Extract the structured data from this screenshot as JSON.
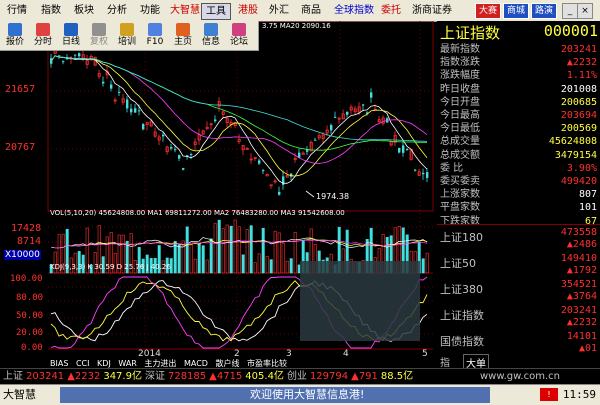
{
  "menu": {
    "items": [
      "行情",
      "指数",
      "板块",
      "分析",
      "功能",
      "大智慧",
      "工具",
      "港股",
      "外汇",
      "商品",
      "全球指数",
      "委托",
      "浙商证券"
    ],
    "right_buttons": [
      "大赛",
      "商城",
      "路演"
    ]
  },
  "toolbar": {
    "items": [
      {
        "label": "报价",
        "color": "#3070d0"
      },
      {
        "label": "分时",
        "color": "#e04040"
      },
      {
        "label": "日线",
        "color": "#2060c0"
      },
      {
        "label": "复权",
        "color": "#909090"
      },
      {
        "label": "培训",
        "color": "#d0a020"
      },
      {
        "label": "F10",
        "color": "#5080e0"
      },
      {
        "label": "主页",
        "color": "#e06020"
      },
      {
        "label": "信息",
        "color": "#4080d0"
      },
      {
        "label": "论坛",
        "color": "#d04080"
      }
    ],
    "overlay_text": "3.75  MA20 2090.16"
  },
  "chart": {
    "price_axis": [
      "21657",
      "20767"
    ],
    "low_marker": "1974.38",
    "vol_line": "VOL(5,10,20)  45624808.00  MA1 69811272.00  MA2 76483280.00  MA3 91542608.00",
    "vol_axis": [
      "17428",
      "8714",
      "X10000"
    ],
    "kdj_line": "KDJ(9,3,3)  K 30.59  D 25.76  J 40.26",
    "kdj_axis": [
      "100.00",
      "80.00",
      "50.00",
      "20.00",
      "0.00"
    ],
    "x_labels": [
      "2014",
      "2",
      "3",
      "4",
      "5"
    ],
    "indicator_tabs": [
      "BIAS",
      "CCI",
      "KDJ",
      "WAR",
      "主力进出",
      "MACD",
      "散户线",
      "市盈率比较"
    ]
  },
  "quote": {
    "title": "上证指数",
    "code": "000001",
    "rows": [
      {
        "k": "最新指数",
        "v": "203241",
        "c": "red"
      },
      {
        "k": "指数涨跌",
        "v": "▲2232",
        "c": "red"
      },
      {
        "k": "涨跌幅度",
        "v": "1.11%",
        "c": "red"
      },
      {
        "k": "昨日收盘",
        "v": "201008",
        "c": "white"
      },
      {
        "k": "今日开盘",
        "v": "200685",
        "c": "yellow"
      },
      {
        "k": "今日最高",
        "v": "203694",
        "c": "red"
      },
      {
        "k": "今日最低",
        "v": "200569",
        "c": "yellow"
      },
      {
        "k": "总成交量",
        "v": "45624808",
        "c": "yellow"
      },
      {
        "k": "总成交额",
        "v": "3479154",
        "c": "yellow"
      },
      {
        "k": "委      比",
        "v": "3.90%",
        "c": "red"
      },
      {
        "k": "委买委卖",
        "v": "499420",
        "c": "red"
      },
      {
        "k": "上涨家数",
        "v": "807",
        "c": "white"
      },
      {
        "k": "平盘家数",
        "v": "101",
        "c": "white"
      },
      {
        "k": "下跌家数",
        "v": "67",
        "c": "yellow"
      }
    ],
    "indices": [
      {
        "name": "上证180",
        "v1": "473558",
        "v2": "▲2486"
      },
      {
        "name": "上证50",
        "v1": "149410",
        "v2": "▲1792"
      },
      {
        "name": "上证380",
        "v1": "354521",
        "v2": "▲3764"
      },
      {
        "name": "上证指数",
        "v1": "203241",
        "v2": "▲2232"
      },
      {
        "name": "国债指数",
        "v1": "14101",
        "v2": "▲01"
      }
    ],
    "tabs": [
      "指",
      "大单"
    ]
  },
  "status": {
    "line1": [
      {
        "t": "上证",
        "c": "#c0c0c0"
      },
      {
        "t": "203241",
        "c": "#ff3030"
      },
      {
        "t": "▲2232",
        "c": "#ff3030"
      },
      {
        "t": "347.9亿",
        "c": "#ffff40"
      },
      {
        "t": "深证",
        "c": "#c0c0c0"
      },
      {
        "t": "728185",
        "c": "#ff3030"
      },
      {
        "t": "▲4715",
        "c": "#ff3030"
      },
      {
        "t": "405.4亿",
        "c": "#ffff40"
      },
      {
        "t": "创业",
        "c": "#c0c0c0"
      },
      {
        "t": "129794",
        "c": "#ff3030"
      },
      {
        "t": "▲791",
        "c": "#ff3030"
      },
      {
        "t": "88.5亿",
        "c": "#ffff40"
      },
      {
        "t": "www.gw.com.cn",
        "c": "#c0c0c0"
      }
    ],
    "app": "大智慧",
    "welcome": "欢迎使用大智慧信息港!",
    "time": "11:59"
  }
}
